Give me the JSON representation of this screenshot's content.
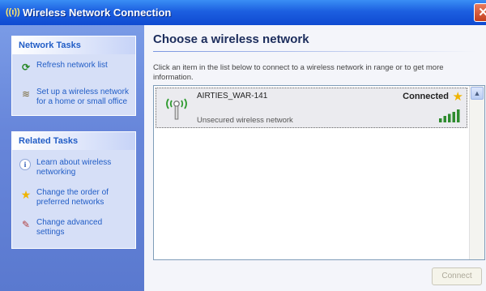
{
  "window": {
    "title": "Wireless Network Connection",
    "close_glyph": "✕"
  },
  "sidebar": {
    "network_tasks": {
      "header": "Network Tasks",
      "items": [
        {
          "label": "Refresh network list",
          "icon": "refresh-icon"
        },
        {
          "label": "Set up a wireless network for a home or small office",
          "icon": "setup-network-icon"
        }
      ]
    },
    "related_tasks": {
      "header": "Related Tasks",
      "items": [
        {
          "label": "Learn about wireless networking",
          "icon": "info-icon"
        },
        {
          "label": "Change the order of preferred networks",
          "icon": "star-icon"
        },
        {
          "label": "Change advanced settings",
          "icon": "settings-icon"
        }
      ]
    }
  },
  "main": {
    "heading": "Choose a wireless network",
    "instructions": "Click an item in the list below to connect to a wireless network in range or to get more information.",
    "networks": [
      {
        "name": "AIRTIES_WAR-141",
        "status": "Connected",
        "security": "Unsecured wireless network",
        "signal_bars": 5
      }
    ],
    "connect_label": "Connect"
  },
  "colors": {
    "title_bar": "#1c5fe0",
    "sidebar": "#6786da",
    "task_link": "#215dc6",
    "star": "#f0b400",
    "signal": "#2e8b2e"
  }
}
